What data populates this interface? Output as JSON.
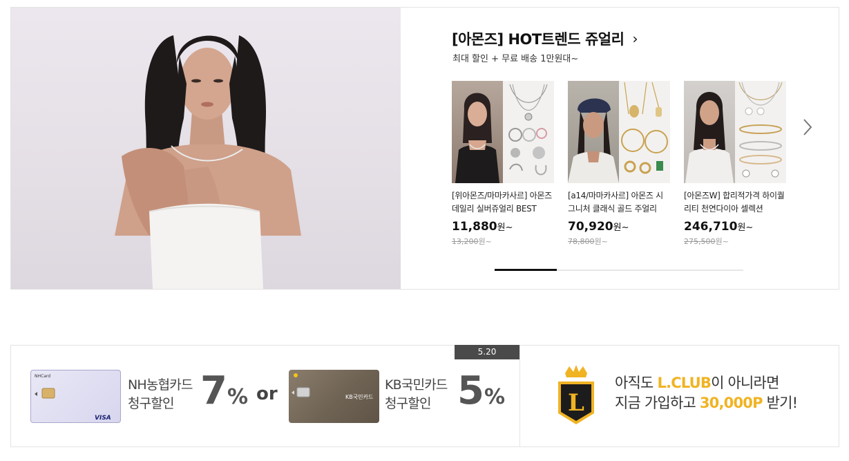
{
  "promo": {
    "title": "[아몬즈] HOT트렌드 쥬얼리",
    "subtitle": "최대 할인 + 무료 배송 1만원대~",
    "products": [
      {
        "name": "[위아몬즈/마마카사르] 아몬즈 데일리 실버쥬얼리 BEST",
        "price": "11,880",
        "price_unit": "원~",
        "original": "13,200",
        "original_unit": "원~"
      },
      {
        "name": "[a14/마마카사르] 아몬즈 시그니처 클래식 골드 주얼리",
        "price": "70,920",
        "price_unit": "원~",
        "original": "78,800",
        "original_unit": "원~"
      },
      {
        "name": "[아몬즈W] 합리적가격 하이퀄리티 천연다이아 셀렉션",
        "price": "246,710",
        "price_unit": "원~",
        "original": "275,500",
        "original_unit": "원~"
      }
    ],
    "progress_fraction": 0.25
  },
  "card_promo": {
    "date_tag": "5.20",
    "nh": {
      "label_line1": "NH농협카드",
      "label_line2": "청구할인",
      "percent": "7",
      "percent_sign": "%"
    },
    "or": "or",
    "kb": {
      "label_line1": "KB국민카드",
      "label_line2": "청구할인",
      "percent": "5",
      "percent_sign": "%"
    },
    "lclub": {
      "line1_pre": "아직도 ",
      "line1_hl": "L.CLUB",
      "line1_post": "이 아니라면",
      "line2_pre": "지금 가입하고 ",
      "line2_hl": "30,000P",
      "line2_post": " 받기!"
    },
    "nh_card_text": {
      "brand": "NHCard",
      "network": "VISA"
    },
    "kb_card_text": {
      "brand": "KB국민카드"
    }
  },
  "colors": {
    "accent_gold": "#f0b323",
    "badge_dark": "#1c1c1c",
    "tag_bg": "#4a4a4a"
  },
  "icons": {
    "next": "chevron-right-icon",
    "title_arrow": "chevron-right-icon",
    "badge": "lclub-crown-badge"
  }
}
